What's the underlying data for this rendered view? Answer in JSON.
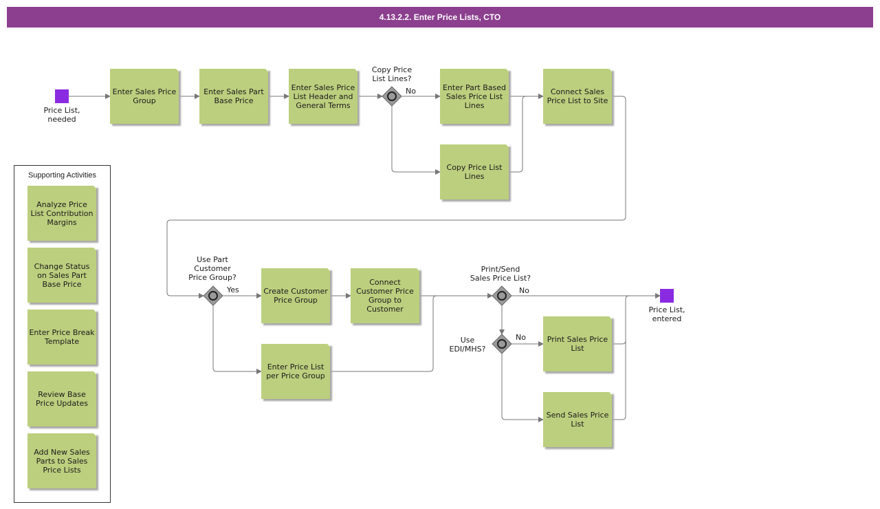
{
  "title": "4.13.2.2. Enter Price Lists, CTO",
  "colors": {
    "title_bar": "#8b3f8e",
    "task_fill": "#bccf7e",
    "event_fill": "#8a2be2",
    "gateway_fill": "#9a9a9a",
    "connector": "#777777"
  },
  "events": {
    "start": {
      "label_line1": "Price List,",
      "label_line2": "needed"
    },
    "end": {
      "label_line1": "Price List,",
      "label_line2": "entered"
    }
  },
  "tasks": {
    "enter_sales_price_group": "Enter Sales Price Group",
    "enter_sales_part_base_price": "Enter Sales Part Base Price",
    "enter_header_terms": "Enter Sales Price List Header and General Terms",
    "enter_part_based_lines": "Enter Part Based Sales Price List Lines",
    "copy_price_list_lines": "Copy Price List Lines",
    "connect_to_site": "Connect Sales Price List to Site",
    "create_customer_price_group": "Create Customer Price Group",
    "connect_group_to_customer": "Connect Customer Price Group to Customer",
    "enter_price_list_per_group": "Enter Price List per Price Group",
    "print_sales_price_list": "Print Sales Price List",
    "send_sales_price_list": "Send Sales Price List"
  },
  "gateways": {
    "copy_lines": {
      "question_line1": "Copy Price",
      "question_line2": "List Lines?",
      "branch": "No"
    },
    "use_part_customer": {
      "question_line1": "Use Part",
      "question_line2": "Customer",
      "question_line3": "Price Group?",
      "branch": "Yes"
    },
    "print_send": {
      "question_line1": "Print/Send",
      "question_line2": "Sales Price List?",
      "branch": "No"
    },
    "use_edi": {
      "question_line1": "Use",
      "question_line2": "EDI/MHS?",
      "branch": "No"
    }
  },
  "supporting": {
    "title": "Supporting Activities",
    "items": [
      "Analyze Price List Contribution Margins",
      "Change Status on Sales Part Base Price",
      "Enter Price Break Template",
      "Review Base Price Updates",
      "Add New Sales Parts to Sales Price Lists"
    ]
  }
}
